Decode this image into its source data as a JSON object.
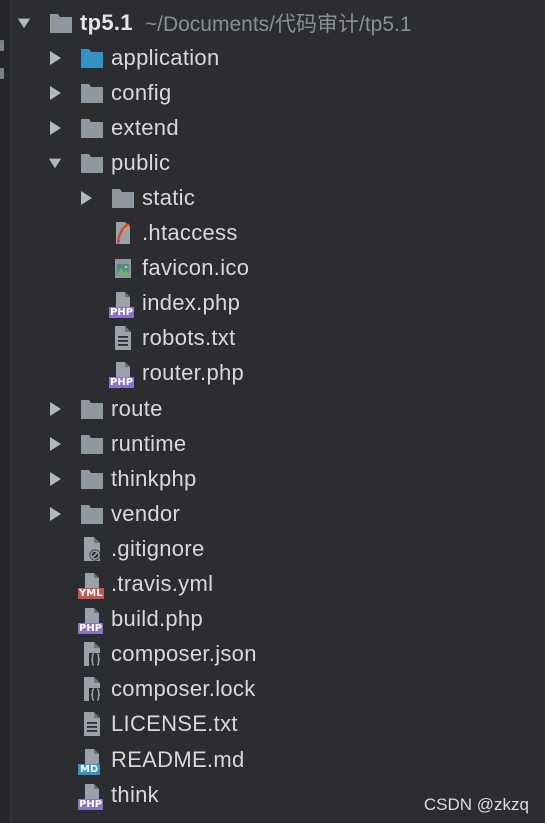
{
  "tree": {
    "root": {
      "name": "tp5.1",
      "path": "~/Documents/代码审计/tp5.1"
    },
    "items": [
      {
        "name": "application",
        "icon": "folder-blue-icon"
      },
      {
        "name": "config",
        "icon": "folder-icon"
      },
      {
        "name": "extend",
        "icon": "folder-icon"
      },
      {
        "name": "public",
        "icon": "folder-icon"
      },
      {
        "name": "static",
        "icon": "folder-icon"
      },
      {
        "name": ".htaccess",
        "icon": "apache-feather-icon"
      },
      {
        "name": "favicon.ico",
        "icon": "image-file-icon"
      },
      {
        "name": "index.php",
        "icon": "php-file-icon"
      },
      {
        "name": "robots.txt",
        "icon": "text-file-icon"
      },
      {
        "name": "router.php",
        "icon": "php-file-icon"
      },
      {
        "name": "route",
        "icon": "folder-icon"
      },
      {
        "name": "runtime",
        "icon": "folder-icon"
      },
      {
        "name": "thinkphp",
        "icon": "folder-icon"
      },
      {
        "name": "vendor",
        "icon": "folder-icon"
      },
      {
        "name": ".gitignore",
        "icon": "ignore-file-icon"
      },
      {
        "name": ".travis.yml",
        "icon": "yml-file-icon"
      },
      {
        "name": "build.php",
        "icon": "php-file-icon"
      },
      {
        "name": "composer.json",
        "icon": "json-file-icon"
      },
      {
        "name": "composer.lock",
        "icon": "json-file-icon"
      },
      {
        "name": "LICENSE.txt",
        "icon": "text-file-icon"
      },
      {
        "name": "README.md",
        "icon": "markdown-file-icon"
      },
      {
        "name": "think",
        "icon": "php-file-icon"
      }
    ]
  },
  "badges": {
    "php": "PHP",
    "yml": "YML",
    "md": "MD"
  },
  "watermark": "CSDN @zkzq",
  "colors": {
    "background": "#2b2d30",
    "folder": "#8f979f",
    "folder_blue": "#3592c4",
    "php_badge": "#8a73c4",
    "yml_badge": "#c75450",
    "md_badge": "#3592c4"
  }
}
